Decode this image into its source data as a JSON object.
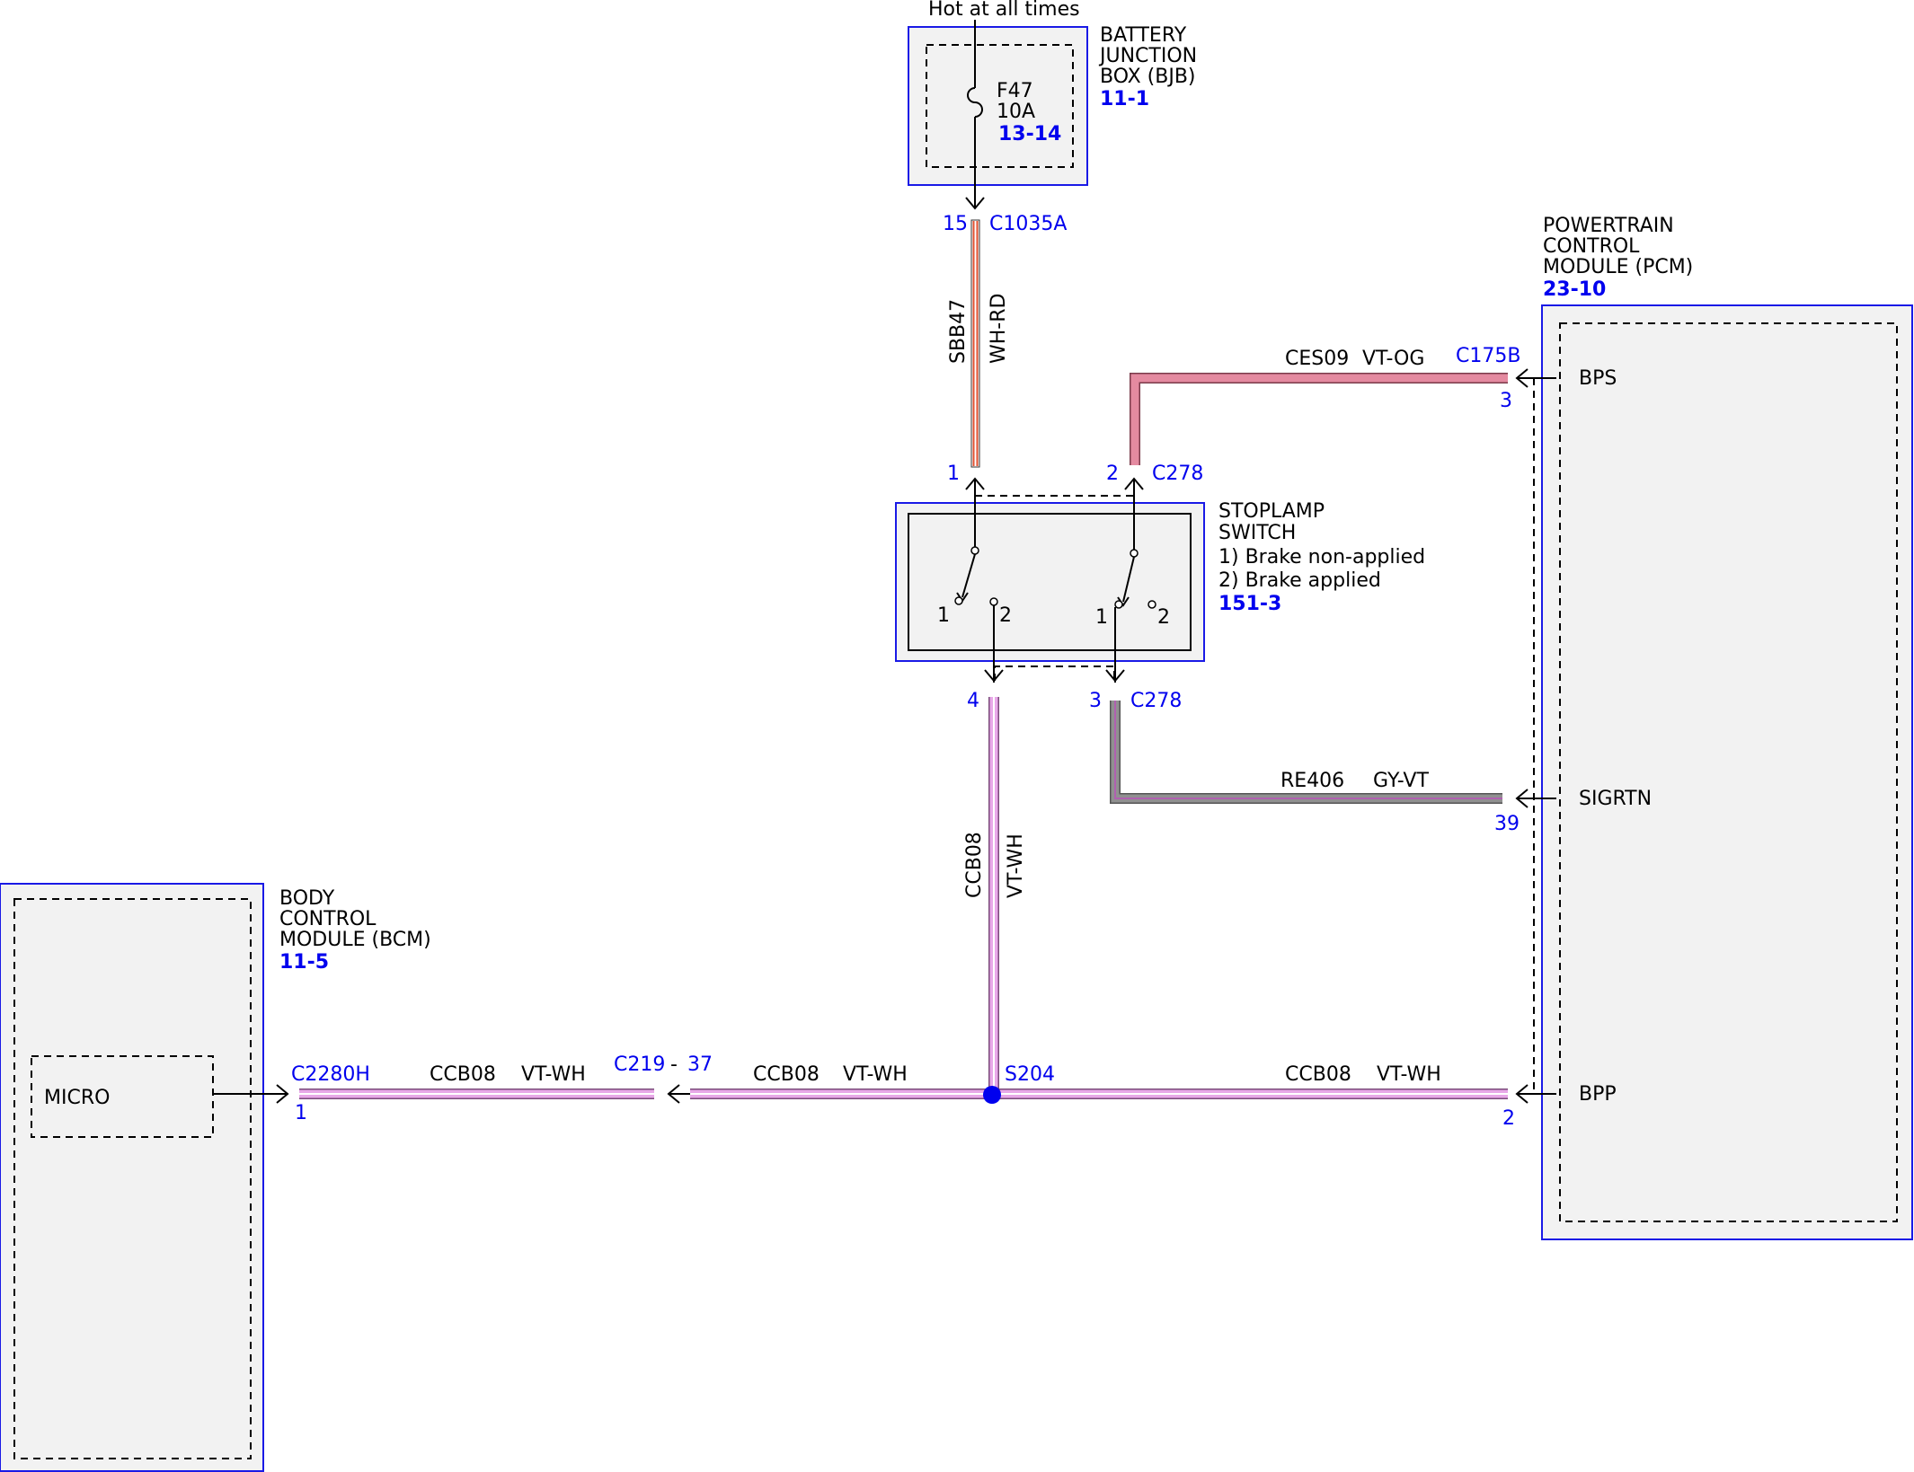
{
  "colors": {
    "module_border": "#1a1ae6",
    "module_fill": "#f2f2f2",
    "label_blue": "#0000ee",
    "wire_wh_rd_white": "#ffffff",
    "wire_wh_rd_red": "#e05030",
    "wire_vt_og_main": "#e48aa0",
    "wire_vt_wh_main": "#e8a8e8",
    "wire_vt_wh_stripe": "#ffffff",
    "wire_gy_vt_main": "#909090",
    "wire_gy_vt_stripe": "#b060b0",
    "splice": "#0000ee"
  },
  "supply": {
    "label": "Hot at all times"
  },
  "bjb": {
    "title_line1": "BATTERY",
    "title_line2": "JUNCTION",
    "title_line3": "BOX (BJB)",
    "ref": "11-1",
    "fuse_name": "F47",
    "fuse_rating": "10A",
    "fuse_ref": "13-14",
    "pin": "15",
    "connector": "C1035A"
  },
  "wire_sbb47": {
    "circuit": "SBB47",
    "color": "WH-RD"
  },
  "stoplamp": {
    "title_line1": "STOPLAMP",
    "title_line2": "SWITCH",
    "note1": "1) Brake non-applied",
    "note2": "2) Brake applied",
    "ref": "151-3",
    "pin_top_left": "1",
    "pin_top_right": "2",
    "conn_top": "C278",
    "pin_bottom_left": "4",
    "pin_bottom_right": "3",
    "conn_bottom": "C278",
    "sw_pos1": "1",
    "sw_pos2": "2"
  },
  "pcm": {
    "title_line1": "POWERTRAIN",
    "title_line2": "CONTROL",
    "title_line3": "MODULE (PCM)",
    "ref": "23-10",
    "connector": "C175B",
    "pin_bps": "3",
    "pin_sigrtn": "39",
    "pin_bpp": "2",
    "sig_bps": "BPS",
    "sig_sigrtn": "SIGRTN",
    "sig_bpp": "BPP"
  },
  "wire_ces09": {
    "circuit": "CES09",
    "color": "VT-OG"
  },
  "wire_re406": {
    "circuit": "RE406",
    "color": "GY-VT"
  },
  "wire_ccb08_vertical": {
    "circuit": "CCB08",
    "color": "VT-WH"
  },
  "wire_ccb08_right": {
    "circuit": "CCB08",
    "color": "VT-WH"
  },
  "wire_ccb08_mid": {
    "circuit": "CCB08",
    "color": "VT-WH"
  },
  "wire_ccb08_left": {
    "circuit": "CCB08",
    "color": "VT-WH"
  },
  "splice": {
    "name": "S204"
  },
  "inline_connector": {
    "name": "C219",
    "separator": "-",
    "pin": "37"
  },
  "bcm": {
    "title_line1": "BODY",
    "title_line2": "CONTROL",
    "title_line3": "MODULE (BCM)",
    "ref": "11-5",
    "connector": "C2280H",
    "pin": "1",
    "micro": "MICRO"
  }
}
